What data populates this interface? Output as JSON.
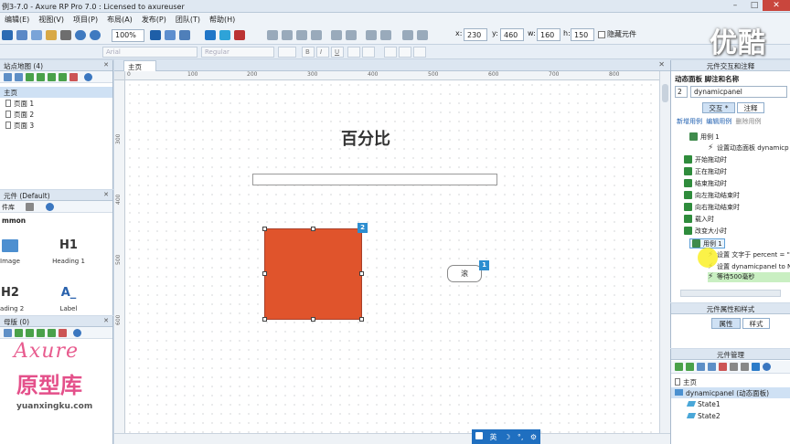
{
  "window": {
    "title": "例3-7.0 - Axure RP Pro 7.0 : Licensed to axureuser"
  },
  "menu": [
    "编辑(E)",
    "视图(V)",
    "项目(P)",
    "布局(A)",
    "发布(P)",
    "团队(T)",
    "帮助(H)"
  ],
  "toolbar": {
    "zoom": "100%",
    "x_label": "x:",
    "x_value": "230",
    "y_label": "y:",
    "y_value": "460",
    "w_label": "w:",
    "w_value": "160",
    "h_label": "h:",
    "h_value": "150",
    "hide_label": "隐藏元件"
  },
  "toolbar2": {
    "font": "Arial",
    "style": "Regular"
  },
  "watermark": "优酷",
  "sitemap": {
    "header": "站点地图 (4)",
    "root": "主页",
    "pages": [
      "页面 1",
      "页面 2",
      "页面 3"
    ]
  },
  "widgets": {
    "header": "元件 (Default)",
    "library_label": "件库",
    "group": "mmon",
    "items": [
      {
        "glyph": "",
        "label": "Image"
      },
      {
        "glyph": "H1",
        "label": "Heading 1"
      },
      {
        "glyph": "H2",
        "label": "eading 2"
      },
      {
        "glyph": "A_",
        "label": "Label"
      }
    ]
  },
  "masters": {
    "header": "母版 (0)"
  },
  "logo": {
    "axure": "Axure",
    "cn": "原型库",
    "url": "yuanxingku.com"
  },
  "canvas": {
    "tab": "主页",
    "title": "百分比",
    "button_label": "滚",
    "badge_panel": "2",
    "badge_button": "1",
    "ruler_h": [
      "0",
      "100",
      "200",
      "300",
      "400",
      "500",
      "600",
      "700",
      "800"
    ],
    "ruler_v": [
      "300",
      "400",
      "500",
      "600"
    ]
  },
  "ime": {
    "items": [
      "英",
      "☽",
      "°,",
      "⚙"
    ]
  },
  "interactions": {
    "header": "元件交互和注释",
    "sub_label": "动态面板 脚注和名称",
    "footnote": "2",
    "name": "dynamicpanel",
    "tab_interact": "交互 *",
    "tab_note": "注释",
    "links": [
      "新增用例",
      "编辑用例",
      "删除用例"
    ],
    "rows": [
      {
        "text": "用例 1",
        "type": "case"
      },
      {
        "text": "设置动态面板 dynamicp",
        "type": "action"
      },
      {
        "text": "开始拖动时",
        "type": "event"
      },
      {
        "text": "正在拖动时",
        "type": "event"
      },
      {
        "text": "结束拖动时",
        "type": "event"
      },
      {
        "text": "向左拖动结束时",
        "type": "event"
      },
      {
        "text": "向右拖动结束时",
        "type": "event"
      },
      {
        "text": "载入时",
        "type": "event"
      },
      {
        "text": "改变大小时",
        "type": "event"
      },
      {
        "text": "用例 1",
        "type": "case"
      },
      {
        "text": "设置 文字于 percent = \"",
        "type": "action"
      },
      {
        "text": "设置 dynamicpanel to N",
        "type": "action"
      },
      {
        "text": "等待500毫秒",
        "type": "action"
      }
    ]
  },
  "props": {
    "header": "元件属性和样式",
    "tab_props": "属性",
    "tab_style": "样式"
  },
  "manager": {
    "header": "元件管理",
    "root": "主页",
    "panel": "dynamicpanel (动态面板)",
    "states": [
      "State1",
      "State2"
    ]
  }
}
